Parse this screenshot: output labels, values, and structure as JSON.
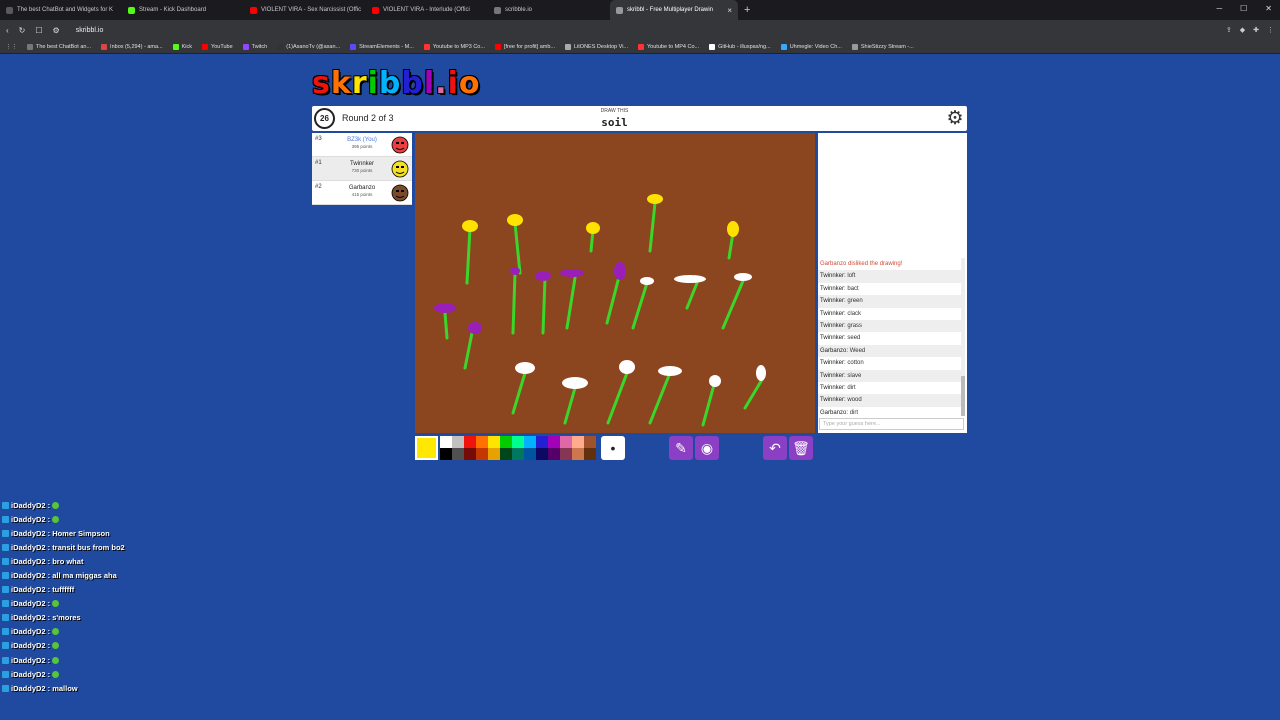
{
  "browser": {
    "tabs": [
      {
        "title": "The best ChatBot and Widgets for K",
        "color": "#5a5a5a"
      },
      {
        "title": "Stream - Kick Dashboard",
        "color": "#53fc18"
      },
      {
        "title": "VIOLENT VIRA - Sex Narcissist (Offic",
        "color": "#ff0000"
      },
      {
        "title": "VIOLENT VIRA - Interlude (Offici",
        "color": "#ff0000"
      },
      {
        "title": "scribble.io",
        "color": "#777777"
      },
      {
        "title": "skribbl - Free Multiplayer Drawin",
        "color": "#999999"
      }
    ],
    "active_tab": 5,
    "url": "skribbl.io",
    "bookmarks": [
      {
        "label": "The best ChatBot an...",
        "color": "#777"
      },
      {
        "label": "Inbox (5,294) - ama...",
        "color": "#d44"
      },
      {
        "label": "Kick",
        "color": "#53fc18"
      },
      {
        "label": "YouTube",
        "color": "#f00"
      },
      {
        "label": "Twitch",
        "color": "#9146ff"
      },
      {
        "label": "(1)AsanoTv (@asan...",
        "color": "#333"
      },
      {
        "label": "StreamElements - M...",
        "color": "#5a4aff"
      },
      {
        "label": "Youtube to MP3 Co...",
        "color": "#f33"
      },
      {
        "label": "[free for profit] amb...",
        "color": "#f00"
      },
      {
        "label": "LitONES Desktop Vi...",
        "color": "#aaa"
      },
      {
        "label": "Youtube to MP4 Co...",
        "color": "#f33"
      },
      {
        "label": "GitHub - illuspas/ng...",
        "color": "#fff"
      },
      {
        "label": "Uhmegle: Video Ch...",
        "color": "#3af"
      },
      {
        "label": "ShieStizzy Stream -...",
        "color": "#999"
      }
    ]
  },
  "game": {
    "logo": "skribbl.io",
    "timer": "26",
    "round": "Round 2 of 3",
    "draw_this": "DRAW THIS",
    "word": "soil",
    "players": [
      {
        "rank": "#3",
        "name": "BZ3k (You)",
        "points": "395 points",
        "you": true,
        "avatar_color": "#e84040"
      },
      {
        "rank": "#1",
        "name": "Twinnker",
        "points": "730 points",
        "you": false,
        "avatar_color": "#f4e020"
      },
      {
        "rank": "#2",
        "name": "Garbanzo",
        "points": "415 points",
        "you": false,
        "avatar_color": "#7a4a2a"
      }
    ],
    "chat": [
      {
        "text": "Garbanzo disliked the drawing!",
        "system": true
      },
      {
        "user": "Twinnker:",
        "text": "loft"
      },
      {
        "user": "Twinnker:",
        "text": "bact"
      },
      {
        "user": "Twinnker:",
        "text": "green"
      },
      {
        "user": "Twinnker:",
        "text": "clack"
      },
      {
        "user": "Twinnker:",
        "text": "grass"
      },
      {
        "user": "Twinnker:",
        "text": "seed"
      },
      {
        "user": "Garbanzo:",
        "text": "Weed"
      },
      {
        "user": "Twinnker:",
        "text": "cotton"
      },
      {
        "user": "Twinnker:",
        "text": "slave"
      },
      {
        "user": "Twinnker:",
        "text": "dirt"
      },
      {
        "user": "Twinnker:",
        "text": "wood"
      },
      {
        "user": "Garbanzo:",
        "text": "dirt"
      }
    ],
    "guess_placeholder": "Type your guess here...",
    "current_color": "#ffe800",
    "palette": [
      "#ffffff",
      "#c1c1c1",
      "#ef130b",
      "#ff7100",
      "#ffe400",
      "#00cc00",
      "#00ff91",
      "#00b2ff",
      "#231fd3",
      "#a300ba",
      "#df69a7",
      "#ffac8e",
      "#a0522d",
      "#000000",
      "#505050",
      "#740b07",
      "#c23800",
      "#e8a200",
      "#004619",
      "#00785d",
      "#00569e",
      "#0e0865",
      "#550069",
      "#873554",
      "#cc774d",
      "#63300d"
    ],
    "brush_size": "•",
    "tools": {
      "pencil": "✎",
      "fill": "◉",
      "undo": "↶",
      "clear": "🗑"
    }
  },
  "twitch_chat": [
    {
      "user": "iDaddyD2 :",
      "text": "",
      "emote": true
    },
    {
      "user": "iDaddyD2 :",
      "text": "",
      "emote": true
    },
    {
      "user": "iDaddyD2 :",
      "text": "Homer Simpson",
      "emote": false
    },
    {
      "user": "iDaddyD2 :",
      "text": "transit bus from bo2",
      "emote": false
    },
    {
      "user": "iDaddyD2 :",
      "text": "bro what",
      "emote": false
    },
    {
      "user": "iDaddyD2 :",
      "text": "all ma miggas aha",
      "emote": false
    },
    {
      "user": "iDaddyD2 :",
      "text": "tuffffff",
      "emote": false
    },
    {
      "user": "iDaddyD2 :",
      "text": "",
      "emote": true
    },
    {
      "user": "iDaddyD2 :",
      "text": "s'mores",
      "emote": false
    },
    {
      "user": "iDaddyD2 :",
      "text": "",
      "emote": true
    },
    {
      "user": "iDaddyD2 :",
      "text": "",
      "emote": true
    },
    {
      "user": "iDaddyD2 :",
      "text": "",
      "emote": true
    },
    {
      "user": "iDaddyD2 :",
      "text": "",
      "emote": true
    },
    {
      "user": "iDaddyD2 :",
      "text": "mallow",
      "emote": false
    }
  ]
}
